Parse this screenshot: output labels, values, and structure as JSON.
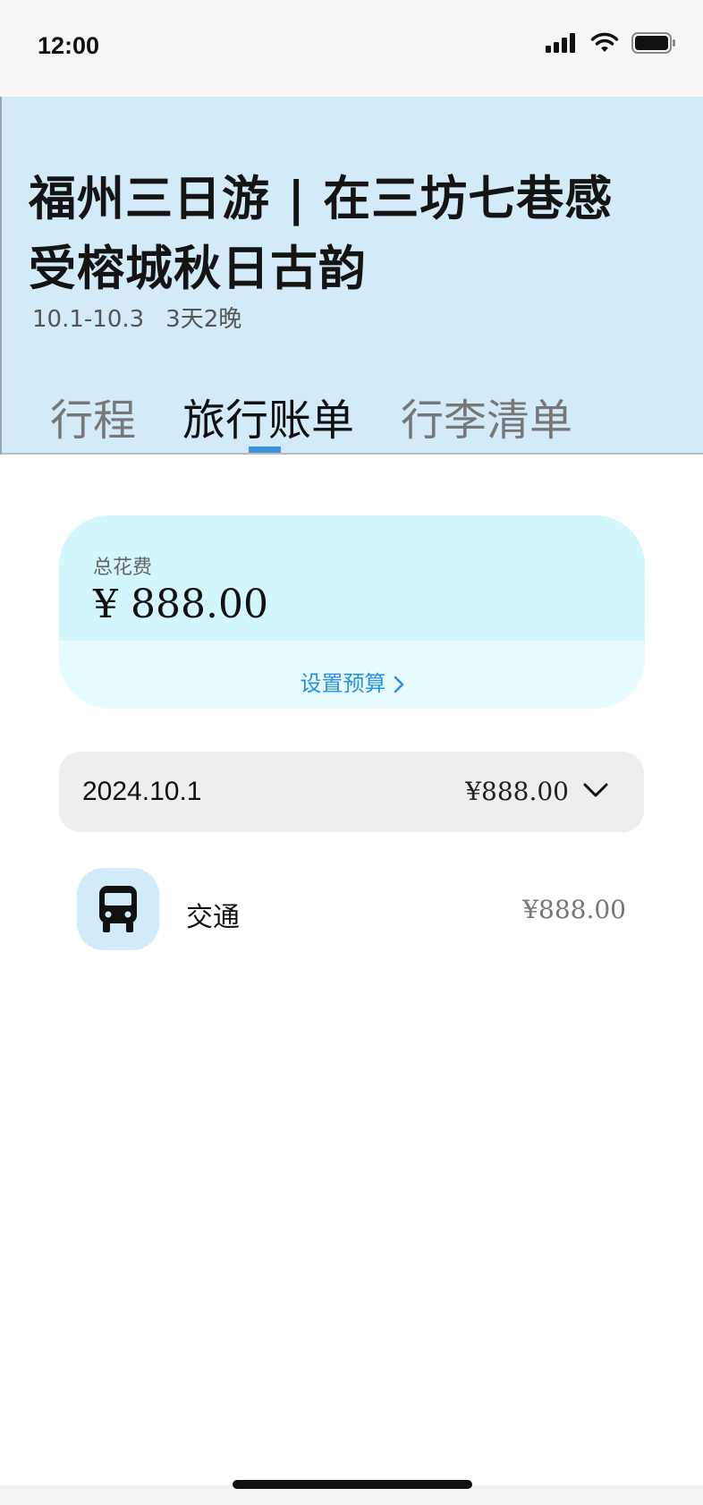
{
  "status_bar": {
    "time": "12:00"
  },
  "trip": {
    "title": "福州三日游 | 在三坊七巷感受榕城秋日古韵",
    "date_range": "10.1-10.3",
    "duration": "3天2晚"
  },
  "tabs": [
    {
      "label": "行程",
      "active": false
    },
    {
      "label": "旅行账单",
      "active": true
    },
    {
      "label": "行李清单",
      "active": false
    }
  ],
  "summary": {
    "label": "总花费",
    "amount": "¥ 888.00",
    "budget_link": "设置预算"
  },
  "day_group": {
    "date": "2024.10.1",
    "total": "¥888.00"
  },
  "expenses": [
    {
      "category": "交通",
      "amount": "¥888.00",
      "icon": "bus-icon"
    }
  ],
  "colors": {
    "header_bg": "#d3eaf8",
    "accent": "#3a94e0",
    "summary_top": "#d3f7fd",
    "summary_bottom": "#e6fbfe",
    "link": "#2d8fde"
  }
}
